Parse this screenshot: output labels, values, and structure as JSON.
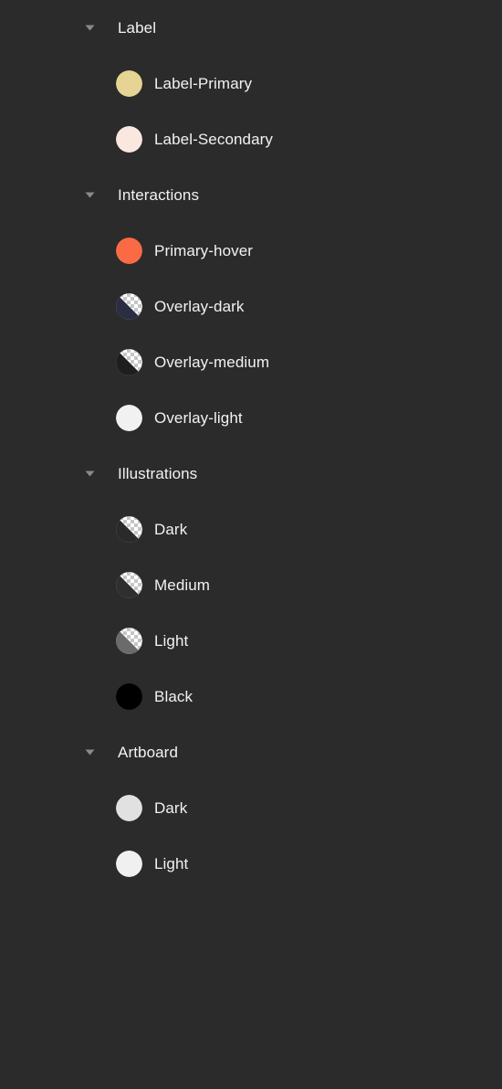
{
  "panel": {
    "background_color": "#2B2B2B",
    "text_color": "#F2F2F2",
    "disclosure_icon_color": "#8A8A8A"
  },
  "groups": [
    {
      "title": "Label",
      "disclosure_icon": "chevron-down-icon",
      "expanded": true,
      "styles": [
        {
          "name": "Label-Primary",
          "swatch_type": "solid",
          "color": "#E6D494"
        },
        {
          "name": "Label-Secondary",
          "swatch_type": "solid",
          "color": "#FAE7E0"
        }
      ]
    },
    {
      "title": "Interactions",
      "disclosure_icon": "chevron-down-icon",
      "expanded": true,
      "styles": [
        {
          "name": "Primary-hover",
          "swatch_type": "solid",
          "color": "#F96A45"
        },
        {
          "name": "Overlay-dark",
          "swatch_type": "alpha",
          "color": "#2B2E42"
        },
        {
          "name": "Overlay-medium",
          "swatch_type": "alpha",
          "color": "#1E1E1E"
        },
        {
          "name": "Overlay-light",
          "swatch_type": "solid",
          "color": "#F1F1F1"
        }
      ]
    },
    {
      "title": "Illustrations",
      "disclosure_icon": "chevron-down-icon",
      "expanded": true,
      "styles": [
        {
          "name": "Dark",
          "swatch_type": "alpha",
          "color": "#2A2A2A"
        },
        {
          "name": "Medium",
          "swatch_type": "alpha",
          "color": "#2F2F2F"
        },
        {
          "name": "Light",
          "swatch_type": "alpha",
          "color": "#6B6B6B"
        },
        {
          "name": "Black",
          "swatch_type": "solid",
          "color": "#000000"
        }
      ]
    },
    {
      "title": "Artboard",
      "disclosure_icon": "chevron-down-icon",
      "expanded": true,
      "styles": [
        {
          "name": "Dark",
          "swatch_type": "solid",
          "color": "#E1E1E1"
        },
        {
          "name": "Light",
          "swatch_type": "solid",
          "color": "#F0F0F0"
        }
      ]
    }
  ]
}
